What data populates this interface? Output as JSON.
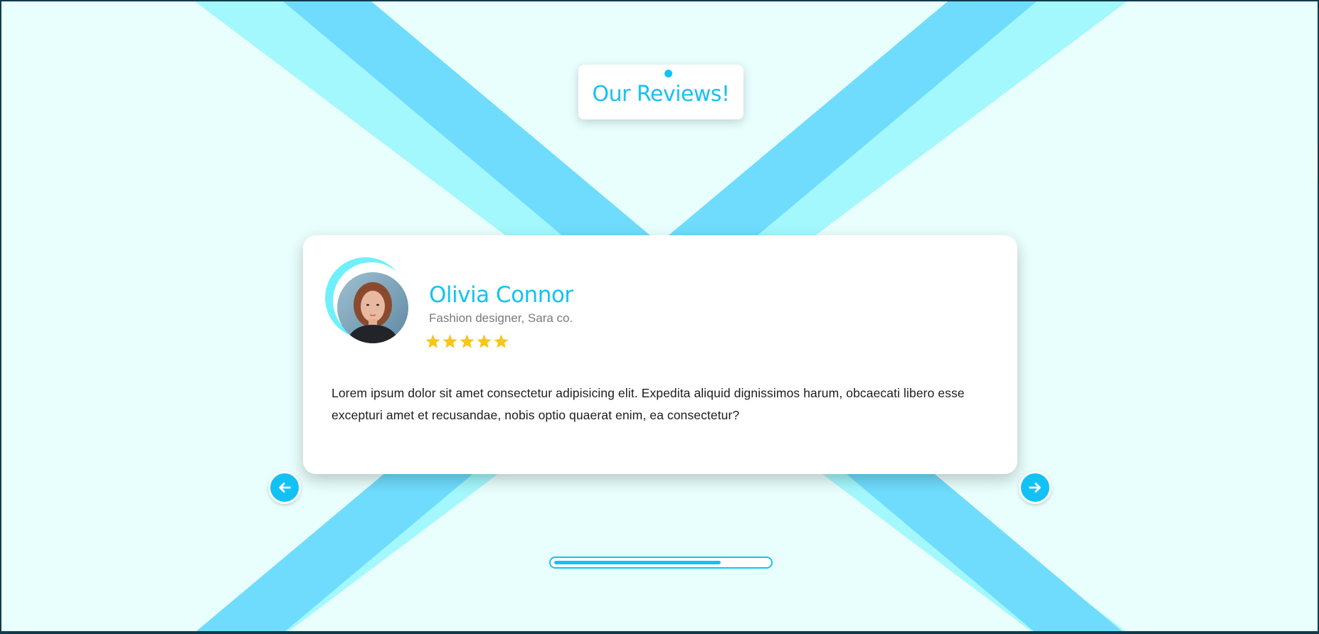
{
  "section": {
    "title": "Our Reviews!"
  },
  "review": {
    "name": "Olivia Connor",
    "role": "Fashion designer, Sara co.",
    "rating": 5,
    "rating_max": 5,
    "text": "Lorem ipsum dolor sit amet consectetur adipisicing elit. Expedita aliquid dignissimos harum, obcaecati libero esse excepturi amet et recusandae, nobis optio quaerat enim, ea consectetur?"
  },
  "navigation": {
    "prev_icon": "arrow-left-icon",
    "next_icon": "arrow-right-icon"
  },
  "progress": {
    "fraction": 0.78
  },
  "colors": {
    "accent": "#13c2f4",
    "background": "#e9fffd",
    "stripe_light": "#a3f8fd",
    "stripe_dark": "#6fdcfe",
    "star": "#f7c51c",
    "text": "#1d1d1d",
    "muted": "#7a7a7a"
  }
}
